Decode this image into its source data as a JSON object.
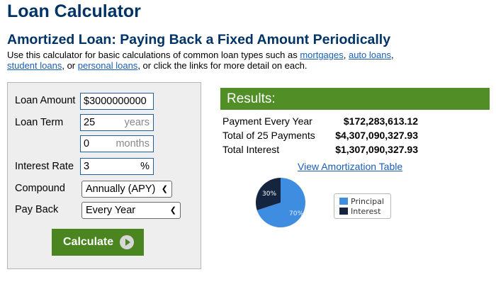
{
  "page": {
    "title": "Loan Calculator",
    "section_title": "Amortized Loan: Paying Back a Fixed Amount Periodically",
    "intro": {
      "text1": "Use this calculator for basic calculations of common loan types such as ",
      "link_mortgages": "mortgages",
      "sep1": ", ",
      "link_auto": "auto loans",
      "sep2": ",",
      "link_student": "student loans",
      "sep3": ", or ",
      "link_personal": "personal loans",
      "text2": ", or click the links for more detail on each."
    }
  },
  "form": {
    "loan_amount": {
      "label": "Loan Amount",
      "value": "$3000000000"
    },
    "loan_term": {
      "label": "Loan Term",
      "years_value": "25",
      "years_unit": "years",
      "months_value": "0",
      "months_unit": "months"
    },
    "interest_rate": {
      "label": "Interest Rate",
      "value": "3",
      "unit": "%"
    },
    "compound": {
      "label": "Compound",
      "selected": "Annually (APY)"
    },
    "pay_back": {
      "label": "Pay Back",
      "selected": "Every Year"
    },
    "calculate_label": "Calculate"
  },
  "results": {
    "header": "Results:",
    "rows": [
      {
        "label": "Payment Every Year",
        "value": "$172,283,613.12"
      },
      {
        "label": "Total of 25 Payments",
        "value": "$4,307,090,327.93"
      },
      {
        "label": "Total Interest",
        "value": "$1,307,090,327.93"
      }
    ],
    "amortization_link": "View Amortization Table",
    "pie": {
      "slices": [
        {
          "name": "Principal",
          "percent": 70,
          "label": "70%",
          "color": "#3f8de0"
        },
        {
          "name": "Interest",
          "percent": 30,
          "label": "30%",
          "color": "#15253f"
        }
      ]
    },
    "legend": [
      "Principal",
      "Interest"
    ]
  },
  "colors": {
    "title": "#003366",
    "link": "#1a5eb1",
    "green": "#518e25",
    "button_green": "#4a8520"
  }
}
